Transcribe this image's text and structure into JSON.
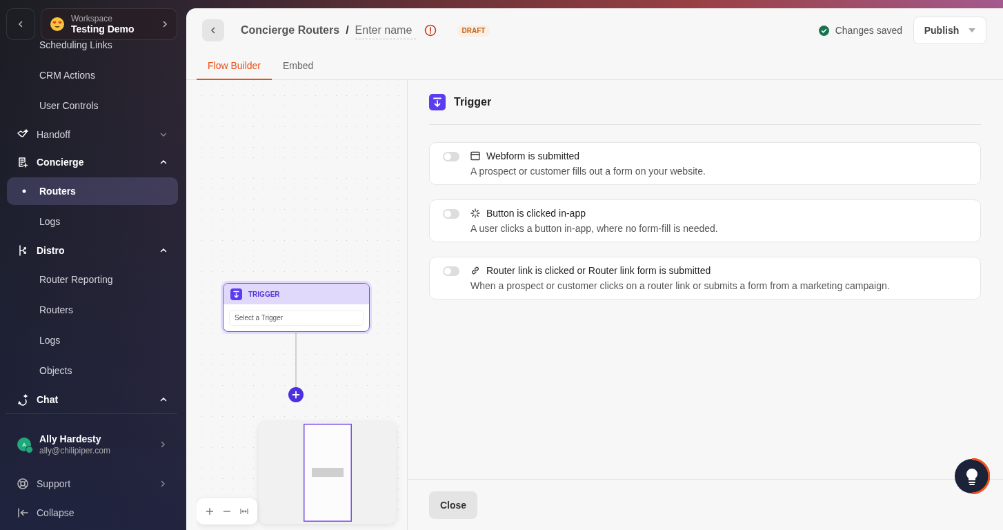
{
  "sidebar": {
    "workspace": {
      "label": "Workspace",
      "name": "Testing Demo"
    },
    "items": [
      {
        "kind": "link",
        "label": "Scheduling Links",
        "selected": false
      },
      {
        "kind": "link",
        "label": "CRM Actions",
        "selected": false
      },
      {
        "kind": "link",
        "label": "User Controls",
        "selected": false
      },
      {
        "kind": "group",
        "label": "Handoff",
        "expanded": false,
        "selected": false
      },
      {
        "kind": "group",
        "label": "Concierge",
        "expanded": true,
        "selected": false
      },
      {
        "kind": "link",
        "label": "Routers",
        "selected": true
      },
      {
        "kind": "link",
        "label": "Logs",
        "selected": false
      },
      {
        "kind": "group",
        "label": "Distro",
        "expanded": true,
        "selected": false
      },
      {
        "kind": "link",
        "label": "Router Reporting",
        "selected": false
      },
      {
        "kind": "link",
        "label": "Routers",
        "selected": false
      },
      {
        "kind": "link",
        "label": "Logs",
        "selected": false
      },
      {
        "kind": "link",
        "label": "Objects",
        "selected": false
      },
      {
        "kind": "group",
        "label": "Chat",
        "expanded": true,
        "selected": false
      }
    ],
    "user": {
      "initial": "A",
      "name": "Ally Hardesty",
      "email": "ally@chilipiper.com"
    },
    "footer": [
      "Support",
      "Collapse"
    ]
  },
  "header": {
    "breadcrumb": "Concierge Routers",
    "separator": "/",
    "name_field": {
      "placeholder": "Enter name"
    },
    "status_badge": "DRAFT",
    "save_status": "Changes saved",
    "publish_button": "Publish"
  },
  "tabs": [
    {
      "label": "Flow Builder",
      "selected": true
    },
    {
      "label": "Embed",
      "selected": false
    }
  ],
  "canvas": {
    "node": {
      "title": "TRIGGER",
      "field": {
        "placeholder": "Select a Trigger"
      }
    }
  },
  "panel": {
    "title": "Trigger",
    "options": [
      {
        "title": "Webform is submitted",
        "description": "A prospect or customer fills out a form on your website.",
        "on": false
      },
      {
        "title": "Button is clicked in-app",
        "description": "A user clicks a button in-app, where no form-fill is needed.",
        "on": false
      },
      {
        "title": "Router link is clicked or Router link form is submitted",
        "description": "When a prospect or customer clicks on a router link or submits a form from a marketing campaign.",
        "on": false
      }
    ],
    "close_button": "Close"
  }
}
